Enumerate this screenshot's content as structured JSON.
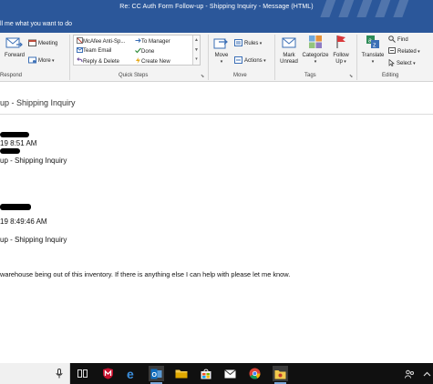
{
  "window": {
    "title": "Re: CC Auth Form Follow-up - Shipping Inquiry  -  Message (HTML)"
  },
  "tell_me": {
    "text": "ll me what you want to do"
  },
  "ribbon": {
    "respond": {
      "label": "Respond",
      "forward": "Forward",
      "meeting": "Meeting",
      "more": "More"
    },
    "quick_steps": {
      "label": "Quick Steps",
      "items": [
        "McAfee Anti-Sp...",
        "Team Email",
        "Reply & Delete",
        "To Manager",
        "Done",
        "Create New"
      ]
    },
    "move": {
      "label": "Move",
      "move": "Move",
      "rules": "Rules",
      "actions": "Actions"
    },
    "tags": {
      "label": "Tags",
      "mark_unread_1": "Mark",
      "mark_unread_2": "Unread",
      "categorize": "Categorize",
      "follow_up_1": "Follow",
      "follow_up_2": "Up"
    },
    "editing": {
      "label": "Editing",
      "translate": "Translate",
      "find": "Find",
      "related": "Related",
      "select": "Select"
    }
  },
  "message": {
    "subject": "up - Shipping Inquiry",
    "first": {
      "time": "19 8:51 AM",
      "subject": "up - Shipping Inquiry"
    },
    "second": {
      "time": "19 8:49:46 AM",
      "subject": "up - Shipping Inquiry"
    },
    "body": "warehouse being out of this inventory.  If there is anything else I can help with please let me know."
  },
  "taskbar": {
    "icons": [
      "microphone-icon",
      "task-view-icon",
      "mcafee-icon",
      "edge-icon",
      "outlook-icon",
      "file-explorer-icon",
      "store-icon",
      "mail-icon",
      "chrome-icon",
      "folder-app-icon"
    ]
  },
  "colors": {
    "titlebar": "#2b579a",
    "ribbon": "#f3f3f3",
    "taskbar": "#101010"
  }
}
